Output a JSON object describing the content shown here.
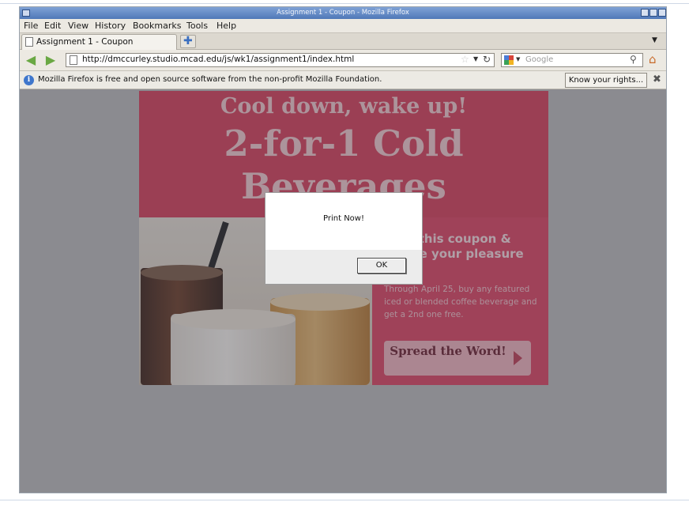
{
  "window": {
    "title": "Assignment 1 - Coupon - Mozilla Firefox"
  },
  "menu": [
    "File",
    "Edit",
    "View",
    "History",
    "Bookmarks",
    "Tools",
    "Help"
  ],
  "tab": {
    "label": "Assignment 1 - Coupon"
  },
  "nav": {
    "url": "http://dmccurley.studio.mcad.edu/js/wk1/assignment1/index.html",
    "search_placeholder": "Google"
  },
  "notification": {
    "text": "Mozilla Firefox is free and open source software from the non-profit Mozilla Foundation.",
    "button": "Know your rights..."
  },
  "coupon": {
    "headline1": "Cool down, wake up!",
    "headline2": "2-for-1 Cold Beverages",
    "promo_title": "Print this coupon & double your pleasure",
    "promo_body": "Through April 25, buy any featured iced or blended coffee beverage and get a 2nd one free.",
    "cta": "Spread the Word!"
  },
  "dialog": {
    "message": "Print Now!",
    "ok": "OK"
  },
  "icons": [
    "window-icon",
    "minimize-icon",
    "maximize-icon",
    "close-icon",
    "page-icon",
    "new-tab-icon",
    "tab-list-arrow-icon",
    "back-arrow-icon",
    "forward-arrow-icon",
    "bookmark-star-icon",
    "url-dropdown-icon",
    "reload-icon",
    "google-icon",
    "search-engine-dropdown-icon",
    "magnifier-icon",
    "home-icon",
    "info-icon",
    "notification-close-icon"
  ],
  "colors": {
    "title_bar": "#5f85c2",
    "banner": "#d93c56",
    "promo": "#e0405f",
    "link_green": "#6aa844"
  }
}
